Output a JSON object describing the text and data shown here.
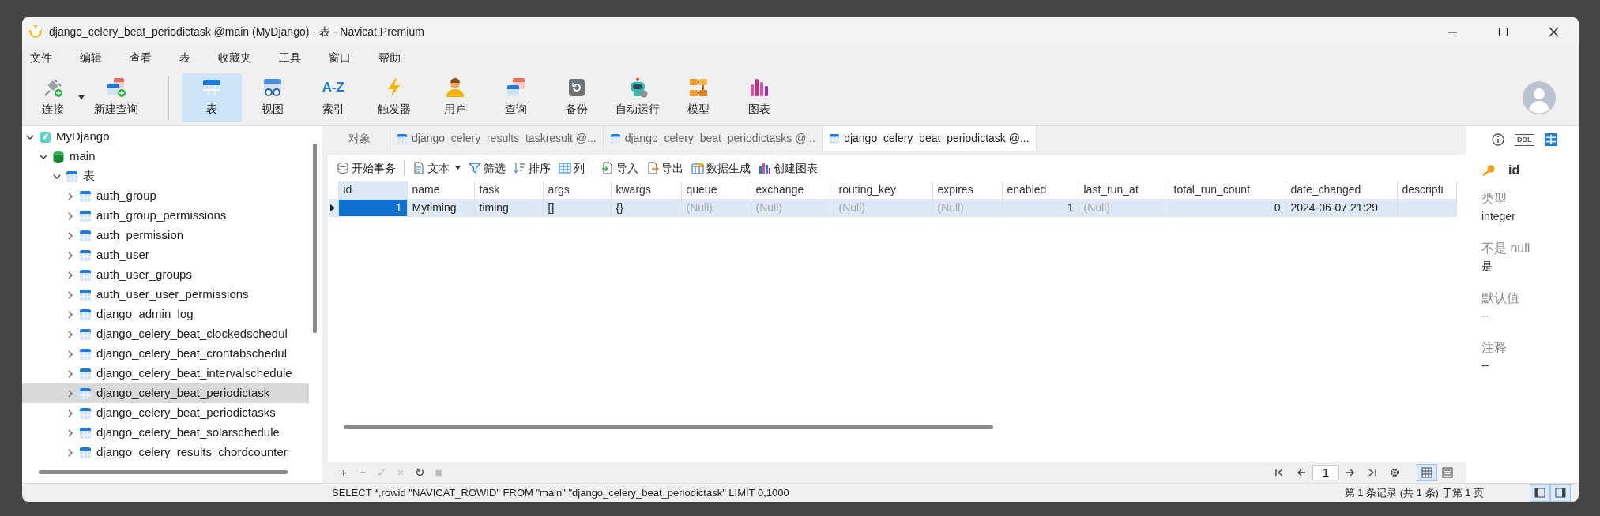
{
  "window": {
    "title": "django_celery_beat_periodictask @main (MyDjango) - 表 - Navicat Premium"
  },
  "menu": [
    "文件",
    "编辑",
    "查看",
    "表",
    "收藏夹",
    "工具",
    "窗口",
    "帮助"
  ],
  "toolbar": {
    "left": [
      {
        "label": "连接",
        "dropdown": true
      },
      {
        "label": "新建查询",
        "dropdown": false
      }
    ],
    "objects": [
      {
        "label": "表",
        "selected": true
      },
      {
        "label": "视图",
        "selected": false
      },
      {
        "label": "索引",
        "selected": false,
        "icon_text": "A-Z"
      },
      {
        "label": "触发器",
        "selected": false
      },
      {
        "label": "用户",
        "selected": false
      },
      {
        "label": "查询",
        "selected": false
      },
      {
        "label": "备份",
        "selected": false
      },
      {
        "label": "自动运行",
        "selected": false
      },
      {
        "label": "模型",
        "selected": false
      },
      {
        "label": "图表",
        "selected": false
      }
    ]
  },
  "sidebar": {
    "tree": [
      {
        "label": "MyDjango",
        "kind": "connection",
        "expanded": true,
        "selected": false,
        "children": [
          {
            "label": "main",
            "kind": "database",
            "expanded": true,
            "selected": false,
            "children": [
              {
                "label": "表",
                "kind": "group",
                "expanded": true,
                "selected": false,
                "children": [
                  {
                    "label": "auth_group",
                    "kind": "table",
                    "expanded": false,
                    "selected": false
                  },
                  {
                    "label": "auth_group_permissions",
                    "kind": "table",
                    "expanded": false,
                    "selected": false
                  },
                  {
                    "label": "auth_permission",
                    "kind": "table",
                    "expanded": false,
                    "selected": false
                  },
                  {
                    "label": "auth_user",
                    "kind": "table",
                    "expanded": false,
                    "selected": false
                  },
                  {
                    "label": "auth_user_groups",
                    "kind": "table",
                    "expanded": false,
                    "selected": false
                  },
                  {
                    "label": "auth_user_user_permissions",
                    "kind": "table",
                    "expanded": false,
                    "selected": false
                  },
                  {
                    "label": "django_admin_log",
                    "kind": "table",
                    "expanded": false,
                    "selected": false
                  },
                  {
                    "label": "django_celery_beat_clockedschedul",
                    "kind": "table",
                    "expanded": false,
                    "selected": false
                  },
                  {
                    "label": "django_celery_beat_crontabschedul",
                    "kind": "table",
                    "expanded": false,
                    "selected": false
                  },
                  {
                    "label": "django_celery_beat_intervalschedule",
                    "kind": "table",
                    "expanded": false,
                    "selected": false
                  },
                  {
                    "label": "django_celery_beat_periodictask",
                    "kind": "table",
                    "expanded": false,
                    "selected": true
                  },
                  {
                    "label": "django_celery_beat_periodictasks",
                    "kind": "table",
                    "expanded": false,
                    "selected": false
                  },
                  {
                    "label": "django_celery_beat_solarschedule",
                    "kind": "table",
                    "expanded": false,
                    "selected": false
                  },
                  {
                    "label": "django_celery_results_chordcounter",
                    "kind": "table",
                    "expanded": false,
                    "selected": false
                  }
                ]
              }
            ]
          }
        ]
      }
    ]
  },
  "tabs": [
    {
      "label": "对象",
      "kind": "objects",
      "selected": false
    },
    {
      "label": "django_celery_results_taskresult @...",
      "kind": "table",
      "selected": false
    },
    {
      "label": "django_celery_beat_periodictasks @...",
      "kind": "table",
      "selected": false
    },
    {
      "label": "django_celery_beat_periodictask @...",
      "kind": "table",
      "selected": true
    }
  ],
  "table_toolbar": [
    [
      {
        "label": "开始事务",
        "dropdown": false
      }
    ],
    [
      {
        "label": "文本",
        "dropdown": true
      },
      {
        "label": "筛选",
        "dropdown": false
      },
      {
        "label": "排序",
        "dropdown": false
      },
      {
        "label": "列",
        "dropdown": false
      }
    ],
    [
      {
        "label": "导入",
        "dropdown": false
      },
      {
        "label": "导出",
        "dropdown": false
      },
      {
        "label": "数据生成",
        "dropdown": false
      },
      {
        "label": "创建图表",
        "dropdown": false
      }
    ]
  ],
  "grid": {
    "columns": [
      "id",
      "name",
      "task",
      "args",
      "kwargs",
      "queue",
      "exchange",
      "routing_key",
      "expires",
      "enabled",
      "last_run_at",
      "total_run_count",
      "date_changed",
      "descripti"
    ],
    "rows": [
      {
        "selected": true,
        "cells": [
          {
            "text": "1",
            "kind": "number",
            "current": true
          },
          {
            "text": "Mytiming",
            "kind": "text",
            "current": false
          },
          {
            "text": "timing",
            "kind": "text",
            "current": false
          },
          {
            "text": "[]",
            "kind": "text",
            "current": false
          },
          {
            "text": "{}",
            "kind": "text",
            "current": false
          },
          {
            "text": "(Null)",
            "kind": "null",
            "current": false
          },
          {
            "text": "(Null)",
            "kind": "null",
            "current": false
          },
          {
            "text": "(Null)",
            "kind": "null",
            "current": false
          },
          {
            "text": "(Null)",
            "kind": "null",
            "current": false
          },
          {
            "text": "1",
            "kind": "number",
            "current": false
          },
          {
            "text": "(Null)",
            "kind": "null",
            "current": false
          },
          {
            "text": "0",
            "kind": "number",
            "current": false
          },
          {
            "text": "2024-06-07 21:29",
            "kind": "text",
            "current": false
          }
        ]
      }
    ]
  },
  "details": {
    "tabs": [
      {
        "kind": "info",
        "selected": false
      },
      {
        "kind": "ddl",
        "selected": false,
        "icon_text": "DDL"
      },
      {
        "kind": "fields",
        "selected": true
      }
    ],
    "field": {
      "name": "id",
      "primary_key": true
    },
    "properties": [
      {
        "label": "类型",
        "value": "integer"
      },
      {
        "label": "不是 null",
        "value": "是"
      },
      {
        "label": "默认值",
        "value": "--"
      },
      {
        "label": "注释",
        "value": "--"
      }
    ]
  },
  "bottom_toolbar": {
    "edit_buttons": [
      {
        "symbol": "+",
        "disabled": false
      },
      {
        "symbol": "−",
        "disabled": false
      },
      {
        "symbol": "✓",
        "disabled": true
      },
      {
        "symbol": "×",
        "disabled": true
      },
      {
        "symbol": "↻",
        "disabled": false
      },
      {
        "symbol": "■",
        "disabled": true
      }
    ],
    "page": "1",
    "views": [
      {
        "kind": "grid",
        "selected": true
      },
      {
        "kind": "form",
        "selected": false
      }
    ]
  },
  "status_bar": {
    "sql": "SELECT *,rowid \"NAVICAT_ROWID\" FROM \"main\".\"django_celery_beat_periodictask\" LIMIT 0,1000",
    "record": "第 1 条记录 (共 1 条) 于第 1 页",
    "panels": [
      {
        "kind": "sidebar",
        "selected": true
      },
      {
        "kind": "details",
        "selected": true
      }
    ]
  }
}
